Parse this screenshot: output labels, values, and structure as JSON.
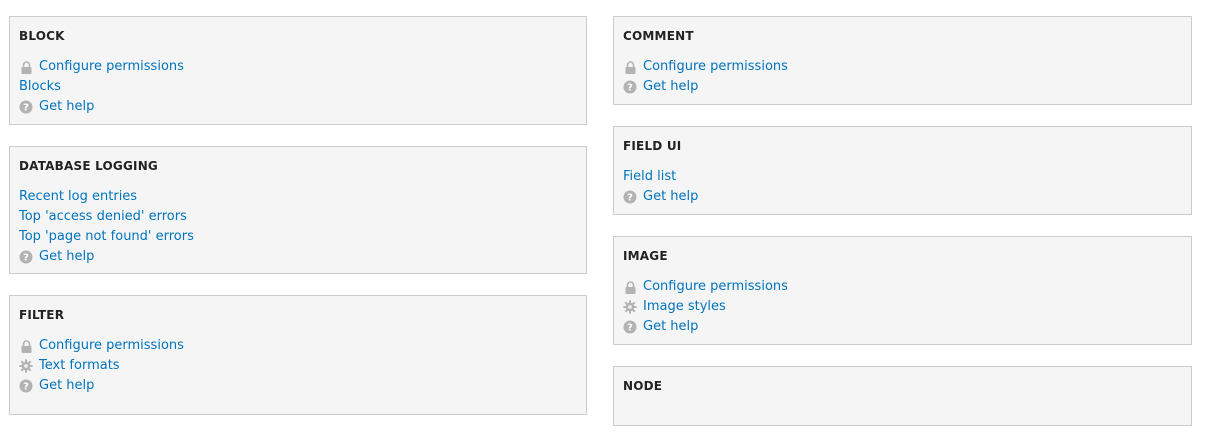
{
  "panels": {
    "block": {
      "title": "BLOCK",
      "items": [
        {
          "label": "Configure permissions",
          "icon": "lock-icon"
        },
        {
          "label": "Blocks"
        },
        {
          "label": "Get help",
          "icon": "help-icon"
        }
      ]
    },
    "database_logging": {
      "title": "DATABASE LOGGING",
      "items": [
        {
          "label": "Recent log entries"
        },
        {
          "label": "Top 'access denied' errors"
        },
        {
          "label": "Top 'page not found' errors"
        },
        {
          "label": "Get help",
          "icon": "help-icon"
        }
      ]
    },
    "filter": {
      "title": "FILTER",
      "items": [
        {
          "label": "Configure permissions",
          "icon": "lock-icon"
        },
        {
          "label": "Text formats",
          "icon": "gear-icon"
        },
        {
          "label": "Get help",
          "icon": "help-icon"
        }
      ]
    },
    "comment": {
      "title": "COMMENT",
      "items": [
        {
          "label": "Configure permissions",
          "icon": "lock-icon"
        },
        {
          "label": "Get help",
          "icon": "help-icon"
        }
      ]
    },
    "field_ui": {
      "title": "FIELD UI",
      "items": [
        {
          "label": "Field list"
        },
        {
          "label": "Get help",
          "icon": "help-icon"
        }
      ]
    },
    "image": {
      "title": "IMAGE",
      "items": [
        {
          "label": "Configure permissions",
          "icon": "lock-icon"
        },
        {
          "label": "Image styles",
          "icon": "gear-icon"
        },
        {
          "label": "Get help",
          "icon": "help-icon"
        }
      ]
    },
    "node": {
      "title": "NODE",
      "items": []
    }
  },
  "colors": {
    "link": "#0074bd",
    "panel_bg": "#f5f5f5",
    "panel_border": "#cccccc",
    "icon": "#b3b3b3"
  }
}
